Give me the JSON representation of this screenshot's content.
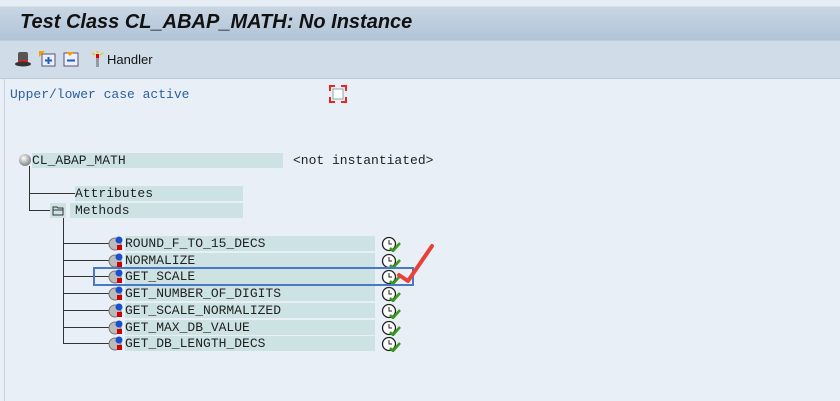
{
  "title": "Test Class CL_ABAP_MATH: No Instance",
  "toolbar": {
    "handler_label": "Handler",
    "icons": [
      "hat-icon",
      "expand-icon",
      "collapse-icon",
      "handler-icon"
    ]
  },
  "status_text": "Upper/lower case active",
  "tree": {
    "root": {
      "label": "CL_ABAP_MATH",
      "value": "<not instantiated>"
    },
    "attributes_label": "Attributes",
    "methods_label": "Methods",
    "methods": [
      "ROUND_F_TO_15_DECS",
      "NORMALIZE",
      "GET_SCALE",
      "GET_NUMBER_OF_DIGITS",
      "GET_SCALE_NORMALIZED",
      "GET_MAX_DB_VALUE",
      "GET_DB_LENGTH_DECS"
    ],
    "highlighted_method": "GET_SCALE"
  },
  "colors": {
    "highlight": "#4a78c4",
    "annotation": "#e8413a",
    "band": "#cde3e3"
  }
}
